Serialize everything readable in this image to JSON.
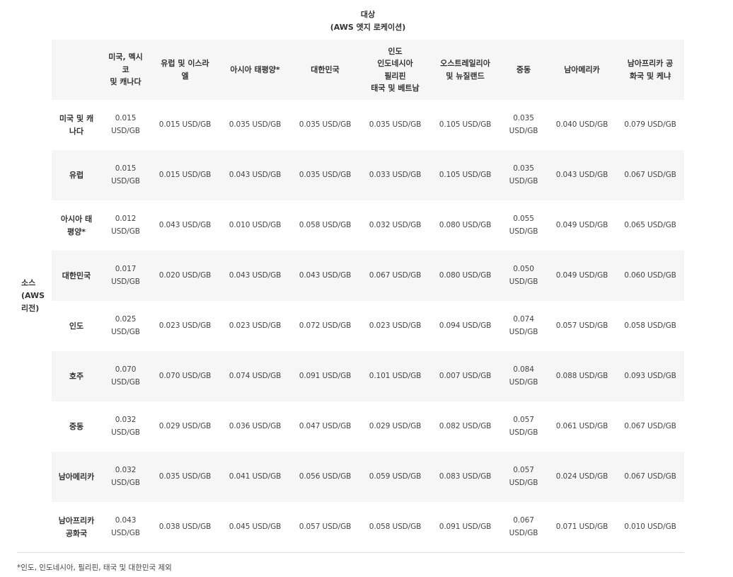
{
  "destination_caption": [
    "대상",
    "(AWS 엣지 로케이션)"
  ],
  "source_caption": [
    "소스",
    "(AWS",
    "리전)"
  ],
  "columns": [
    "",
    "미국, 멕시\n코\n및 캐나다",
    "유럽 및 이스라\n엘",
    "아시아 태평양*",
    "대한민국",
    "인도\n인도네시아\n필리핀\n태국 및 베트남",
    "오스트레일리아\n및 뉴질랜드",
    "중동",
    "남아메리카",
    "남아프리카 공\n화국 및 케냐"
  ],
  "rows": [
    {
      "source": "미국 및 캐\n나다",
      "prices": [
        "0.015\nUSD/GB",
        "0.015 USD/GB",
        "0.035 USD/GB",
        "0.035 USD/GB",
        "0.035 USD/GB",
        "0.105 USD/GB",
        "0.035\nUSD/GB",
        "0.040 USD/GB",
        "0.079 USD/GB"
      ]
    },
    {
      "source": "유럽",
      "prices": [
        "0.015\nUSD/GB",
        "0.015 USD/GB",
        "0.043 USD/GB",
        "0.035 USD/GB",
        "0.033 USD/GB",
        "0.105 USD/GB",
        "0.035\nUSD/GB",
        "0.043 USD/GB",
        "0.067 USD/GB"
      ]
    },
    {
      "source": "아시아 태\n평양*",
      "prices": [
        "0.012\nUSD/GB",
        "0.043 USD/GB",
        "0.010 USD/GB",
        "0.058 USD/GB",
        "0.032 USD/GB",
        "0.080 USD/GB",
        "0.055\nUSD/GB",
        "0.049 USD/GB",
        "0.065 USD/GB"
      ]
    },
    {
      "source": "대한민국",
      "prices": [
        "0.017\nUSD/GB",
        "0.020 USD/GB",
        "0.043 USD/GB",
        "0.043 USD/GB",
        "0.067 USD/GB",
        "0.080 USD/GB",
        "0.050\nUSD/GB",
        "0.049 USD/GB",
        "0.060 USD/GB"
      ]
    },
    {
      "source": "인도",
      "prices": [
        "0.025\nUSD/GB",
        "0.023 USD/GB",
        "0.023 USD/GB",
        "0.072 USD/GB",
        "0.023 USD/GB",
        "0.094 USD/GB",
        "0.074\nUSD/GB",
        "0.057 USD/GB",
        "0.058 USD/GB"
      ]
    },
    {
      "source": "호주",
      "prices": [
        "0.070\nUSD/GB",
        "0.070 USD/GB",
        "0.074 USD/GB",
        "0.091 USD/GB",
        "0.101 USD/GB",
        "0.007 USD/GB",
        "0.084\nUSD/GB",
        "0.088 USD/GB",
        "0.093 USD/GB"
      ]
    },
    {
      "source": "중동",
      "prices": [
        "0.032\nUSD/GB",
        "0.029 USD/GB",
        "0.036 USD/GB",
        "0.047 USD/GB",
        "0.029 USD/GB",
        "0.082 USD/GB",
        "0.057\nUSD/GB",
        "0.061 USD/GB",
        "0.067 USD/GB"
      ]
    },
    {
      "source": "남아메리카",
      "prices": [
        "0.032\nUSD/GB",
        "0.035 USD/GB",
        "0.041 USD/GB",
        "0.056 USD/GB",
        "0.059 USD/GB",
        "0.083 USD/GB",
        "0.057\nUSD/GB",
        "0.024 USD/GB",
        "0.067 USD/GB"
      ]
    },
    {
      "source": "남아프리카\n공화국",
      "prices": [
        "0.043\nUSD/GB",
        "0.038 USD/GB",
        "0.045 USD/GB",
        "0.057 USD/GB",
        "0.058 USD/GB",
        "0.091 USD/GB",
        "0.067\nUSD/GB",
        "0.071 USD/GB",
        "0.010 USD/GB"
      ]
    }
  ],
  "footnote": "*인도, 인도네시아, 필리핀, 태국 및 대한민국 제외"
}
